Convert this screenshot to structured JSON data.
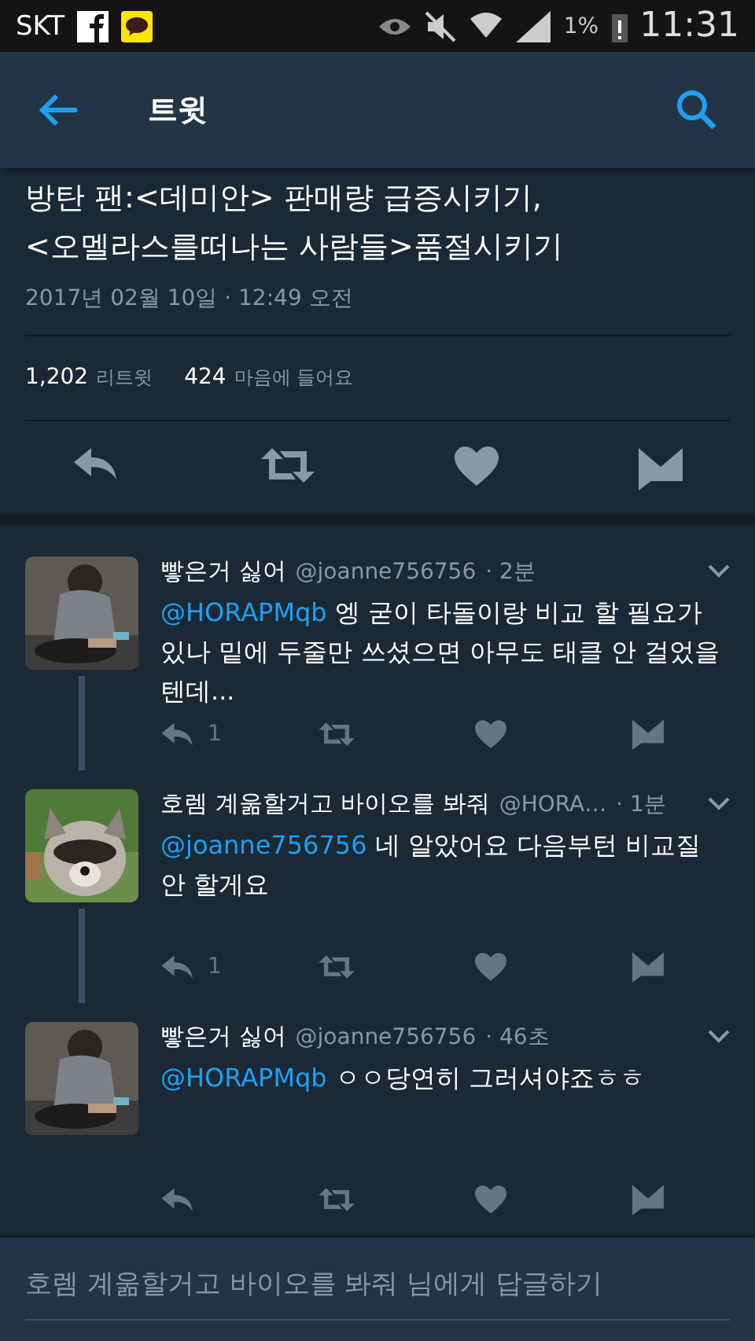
{
  "status_bar": {
    "carrier": "SKT",
    "battery": "1%",
    "time": "11:31"
  },
  "header": {
    "title": "트윗"
  },
  "tweet": {
    "text_lines": [
      "방탄 팬:<데미안> 판매량 급증시키기,",
      "<오멜라스를떠나는 사람들>품절시키기"
    ],
    "date": "2017년 02월 10일 · 12:49 오전",
    "stats": [
      {
        "count": "1,202",
        "label": "리트윗"
      },
      {
        "count": "424",
        "label": "마음에 들어요"
      }
    ]
  },
  "replies": [
    {
      "name": "빻은거 싫어",
      "handle": "@joanne756756",
      "time": "· 2분",
      "mention": "@HORAPMqb",
      "text": "엥 굳이 타돌이랑 비교 할 필요가 있나 밑에 두줄만 쓰셨으면 아무도 태클 안 걸었을 텐데...",
      "reply_count": "1"
    },
    {
      "name": "호렘 계욺할거고 바이오를 봐줘",
      "handle": "@HORA…",
      "time": "· 1분",
      "mention": "@joanne756756",
      "text": "네 알았어요 다음부턴 비교질 안 할게요",
      "reply_count": "1"
    },
    {
      "name": "빻은거 싫어",
      "handle": "@joanne756756",
      "time": "· 46초",
      "mention": "@HORAPMqb",
      "text": "ㅇㅇ당연히 그러셔야죠ㅎㅎ"
    }
  ],
  "reply_box": {
    "placeholder": "호렘 계욺할거고 바이오를 봐줘 님에게 답글하기"
  }
}
